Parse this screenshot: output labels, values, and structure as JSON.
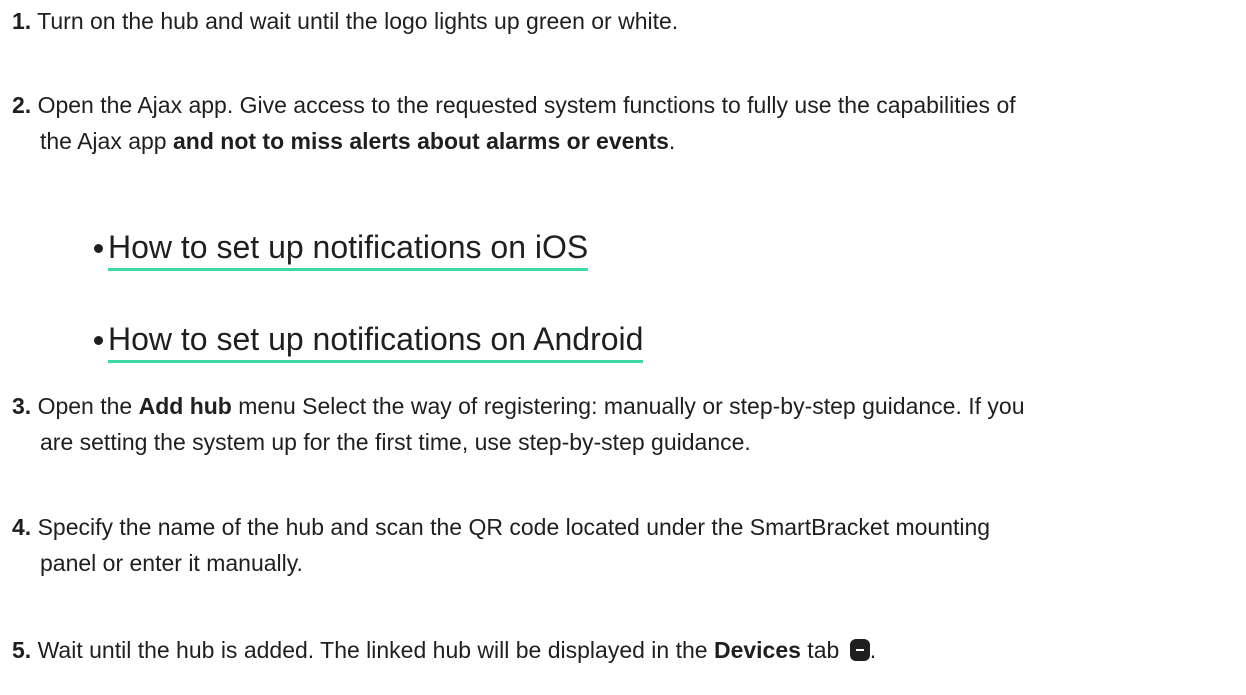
{
  "steps": [
    {
      "number": "1.",
      "text": "Turn on the hub and wait until the logo lights up green or white."
    },
    {
      "number": "2.",
      "line1": "Open the Ajax app. Give access to the requested system functions to fully use the capabilities of",
      "line2_pre": "the Ajax app ",
      "line2_bold": "and not to miss alerts about alarms or events",
      "line2_post": "."
    },
    {
      "number": "3.",
      "pre": "Open the ",
      "bold": "Add hub",
      "line1_post": " menu Select the way of registering: manually or step-by-step guidance. If you",
      "line2": "are setting the system up for the first time, use step-by-step guidance."
    },
    {
      "number": "4.",
      "line1": "Specify the name of the hub and scan the QR code located under the SmartBracket mounting",
      "line2": "panel or enter it manually."
    },
    {
      "number": "5.",
      "pre": "Wait until the hub is added. The linked hub will be displayed in the ",
      "bold": "Devices",
      "post": " tab",
      "end": "."
    }
  ],
  "links": [
    {
      "label": "How to set up notifications on iOS"
    },
    {
      "label": "How to set up notifications on Android"
    }
  ],
  "colors": {
    "text": "#1f1f1f",
    "link_underline": "#3fd9a8"
  },
  "icons": {
    "devices_tab": "devices-tab-icon"
  }
}
